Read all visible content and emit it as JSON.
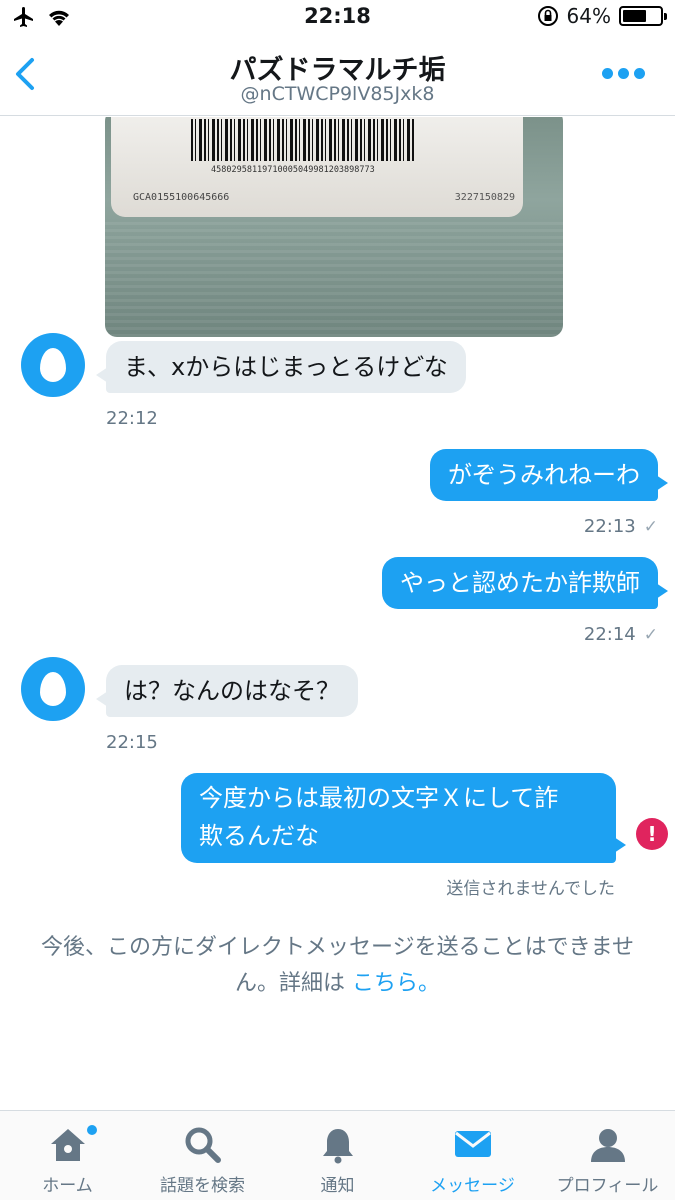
{
  "status_bar": {
    "time": "22:18",
    "battery_percent": "64%",
    "battery_level": 0.64
  },
  "header": {
    "title": "パズドラマルチ垢",
    "handle": "@nCTWCP9lV85Jxk8"
  },
  "photo": {
    "barcode_number": "4580295811971000504998120389877​3",
    "card_code": "GCA0155100645666",
    "card_serial": "3227150829"
  },
  "messages": [
    {
      "direction": "in",
      "text": "ま、xからはじまっとるけどな",
      "time": "22:12"
    },
    {
      "direction": "out",
      "text": "がぞうみれねーわ",
      "time": "22:13",
      "read_mark": "✓"
    },
    {
      "direction": "out",
      "text": "やっと認めたか詐欺師",
      "time": "22:14",
      "read_mark": "✓"
    },
    {
      "direction": "in",
      "text": "は？なんのはなそ？",
      "time": "22:15"
    },
    {
      "direction": "out",
      "text_line1": "今度からは最初の文字Ｘにして詐",
      "text_line2": "欺るんだな",
      "error": "!",
      "status": "送信されませんでした"
    }
  ],
  "notice": {
    "text": "今後、この方にダイレクトメッセージを送ることはできません。詳細は ",
    "link": "こちら。"
  },
  "tabs": [
    {
      "label": "ホーム",
      "icon": "home-icon",
      "badge": true
    },
    {
      "label": "話題を検索",
      "icon": "search-icon"
    },
    {
      "label": "通知",
      "icon": "bell-icon"
    },
    {
      "label": "メッセージ",
      "icon": "envelope-icon",
      "active": true
    },
    {
      "label": "プロフィール",
      "icon": "profile-icon"
    }
  ],
  "colors": {
    "accent": "#1da1f2",
    "incoming_bubble": "#e6ecf0",
    "error": "#e0245e",
    "muted_text": "#657786"
  }
}
